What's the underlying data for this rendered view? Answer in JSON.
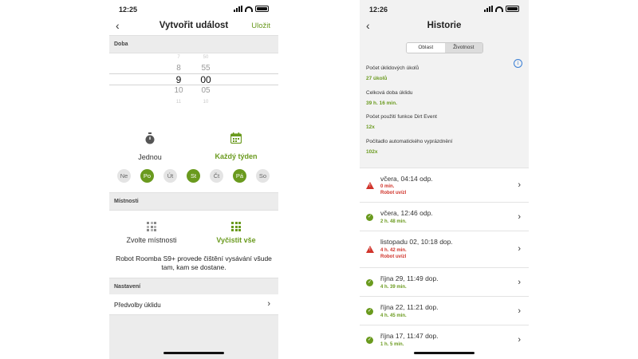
{
  "left": {
    "status": {
      "time": "12:25"
    },
    "nav": {
      "back": "‹",
      "title": "Vytvořit událost",
      "save": "Uložit"
    },
    "sections": {
      "doba": "Doba",
      "mistnosti": "Místnosti",
      "nastaveni": "Nastavení"
    },
    "picker": {
      "hours": [
        "7",
        "8",
        "9",
        "10",
        "11"
      ],
      "minutes": [
        "50",
        "55",
        "00",
        "05",
        "10"
      ]
    },
    "repeat": {
      "once": "Jednou",
      "weekly": "Každý týden",
      "selected": "weekly"
    },
    "days": [
      {
        "label": "Ne",
        "on": false
      },
      {
        "label": "Po",
        "on": true
      },
      {
        "label": "Út",
        "on": false
      },
      {
        "label": "St",
        "on": true
      },
      {
        "label": "Čt",
        "on": false
      },
      {
        "label": "Pá",
        "on": true
      },
      {
        "label": "So",
        "on": false
      }
    ],
    "rooms": {
      "choose": "Zvolte místnosti",
      "clean_all": "Vyčistit vše",
      "selected": "clean_all"
    },
    "description": "Robot Roomba S9+ provede čištění vysávání všude tam, kam se dostane.",
    "settings_item": "Předvolby úklidu"
  },
  "right": {
    "status": {
      "time": "12:26"
    },
    "nav": {
      "back": "‹",
      "title": "Historie"
    },
    "tabs": [
      {
        "label": "Oblast",
        "active": false
      },
      {
        "label": "Životnost",
        "active": true
      }
    ],
    "stats": [
      {
        "label": "Počet úklidových úkolů",
        "value": "27 úkolů"
      },
      {
        "label": "Celková doba úklidu",
        "value": "39 h. 16 min."
      },
      {
        "label": "Počet použití funkce Dirt Event",
        "value": "12x"
      },
      {
        "label": "Počítadlo automatického vyprázdnění",
        "value": "102x"
      }
    ],
    "history": [
      {
        "date": "včera, 04:14 odp.",
        "duration": "0 min.",
        "status": "error",
        "error": "Robot uvízl"
      },
      {
        "date": "včera, 12:46 odp.",
        "duration": "2 h. 48 min.",
        "status": "ok",
        "error": ""
      },
      {
        "date": "listopadu 02, 10:18 dop.",
        "duration": "4 h. 42 min.",
        "status": "error",
        "error": "Robot uvízl"
      },
      {
        "date": "října 29, 11:49 dop.",
        "duration": "4 h. 39 min.",
        "status": "ok",
        "error": ""
      },
      {
        "date": "října 22, 11:21 dop.",
        "duration": "4 h. 45 min.",
        "status": "ok",
        "error": ""
      },
      {
        "date": "října 17, 11:47 dop.",
        "duration": "1 h. 5 min.",
        "status": "ok",
        "error": ""
      }
    ]
  },
  "colors": {
    "accent": "#6a9a1e",
    "error": "#d0332a",
    "info": "#3a7fd5",
    "section_bg": "#ececec"
  }
}
